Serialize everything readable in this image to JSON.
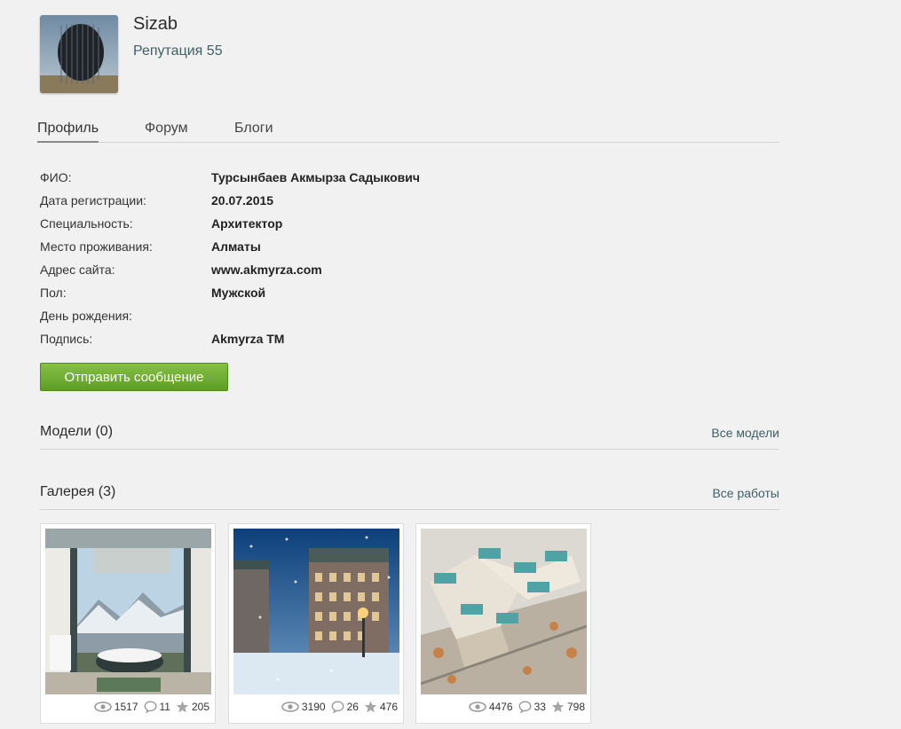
{
  "user": {
    "name": "Sizab",
    "reputation": "Репутация 55"
  },
  "tabs": [
    {
      "label": "Профиль",
      "active": true
    },
    {
      "label": "Форум",
      "active": false
    },
    {
      "label": "Блоги",
      "active": false
    }
  ],
  "profile": [
    {
      "label": "ФИО:",
      "value": "Турсынбаев Акмырза Садыкович"
    },
    {
      "label": "Дата регистрации:",
      "value": "20.07.2015"
    },
    {
      "label": "Специальность:",
      "value": "Архитектор"
    },
    {
      "label": "Место проживания:",
      "value": "Алматы"
    },
    {
      "label": "Адрес сайта:",
      "value": "www.akmyrza.com"
    },
    {
      "label": "Пол:",
      "value": "Мужской"
    },
    {
      "label": "День рождения:",
      "value": ""
    },
    {
      "label": "Подпись:",
      "value": "Akmyrza TM"
    }
  ],
  "send_message_label": "Отправить сообщение",
  "models": {
    "title": "Модели (0)",
    "link": "Все модели"
  },
  "gallery": {
    "title": "Галерея (3)",
    "link": "Все работы",
    "items": [
      {
        "views": "1517",
        "comments": "11",
        "rating": "205",
        "image": "bathroom-interior-mountain-view"
      },
      {
        "views": "3190",
        "comments": "26",
        "rating": "476",
        "image": "winter-night-building"
      },
      {
        "views": "4476",
        "comments": "33",
        "rating": "798",
        "image": "residential-complex-aerial"
      }
    ]
  },
  "icons": {
    "views": "eye-icon",
    "comments": "comment-icon",
    "rating": "star-icon"
  },
  "colors": {
    "accent_link": "#3f5f66",
    "button_green": "#6aaa2f",
    "background": "#f1f1f1"
  }
}
